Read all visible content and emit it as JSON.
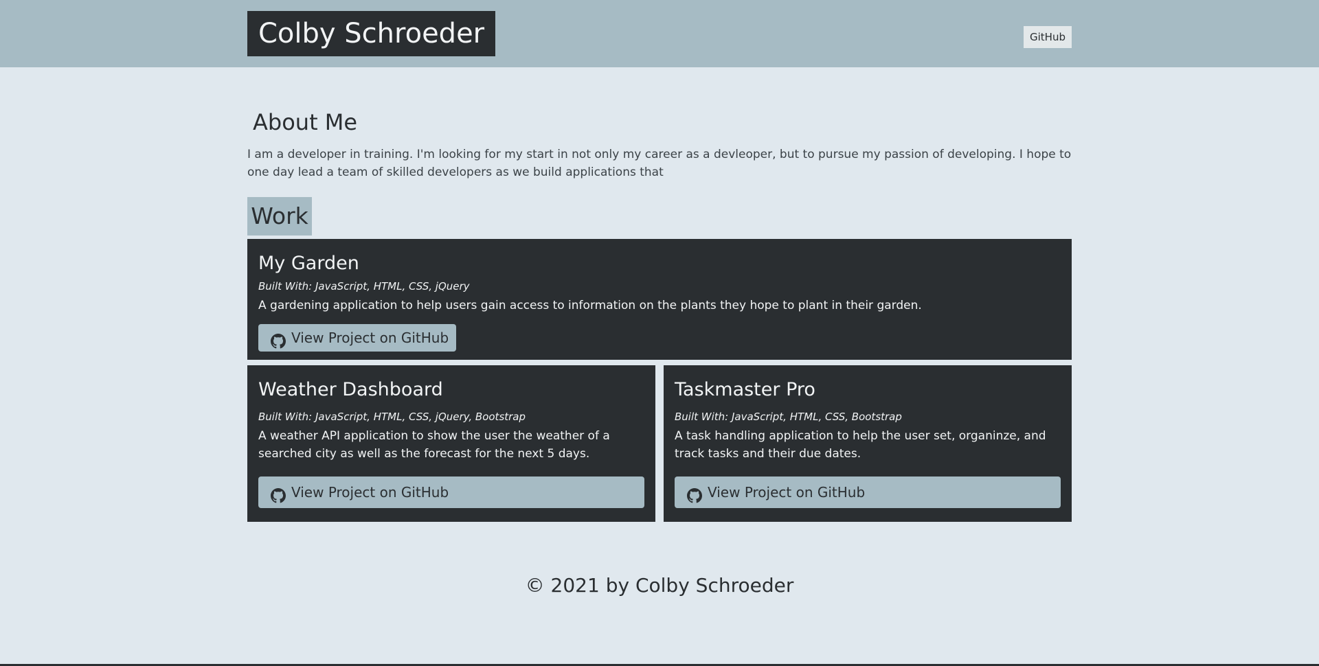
{
  "header": {
    "brand": "Colby Schroeder",
    "nav_github": "GitHub"
  },
  "about": {
    "title": "About Me",
    "text": "I am a developer in training. I'm looking for my start in not only my career as a devleoper, but to pursue my passion of developing. I hope to one day lead a team of skilled developers as we build applications that"
  },
  "work": {
    "title": "Work",
    "projects": [
      {
        "title": "My Garden",
        "built": "Built With: JavaScript, HTML, CSS, jQuery",
        "desc": "A gardening application to help users gain access to information on the plants they hope to plant in their garden.",
        "button": "View Project on GitHub"
      },
      {
        "title": "Weather Dashboard",
        "built": "Built With: JavaScript, HTML, CSS, jQuery, Bootstrap",
        "desc": "A weather API application to show the user the weather of a searched city as well as the forecast for the next 5 days.",
        "button": "View Project on GitHub"
      },
      {
        "title": "Taskmaster Pro",
        "built": "Built With: JavaScript, HTML, CSS, Bootstrap",
        "desc": "A task handling application to help the user set, organinze, and track tasks and their due dates.",
        "button": "View Project on GitHub"
      }
    ]
  },
  "footer": {
    "text": "© 2021 by Colby Schroeder"
  },
  "colors": {
    "header_bg": "#a6bbc4",
    "page_bg": "#e0e8ee",
    "card_bg": "#2a2e31",
    "button_bg": "#a6bbc4"
  }
}
